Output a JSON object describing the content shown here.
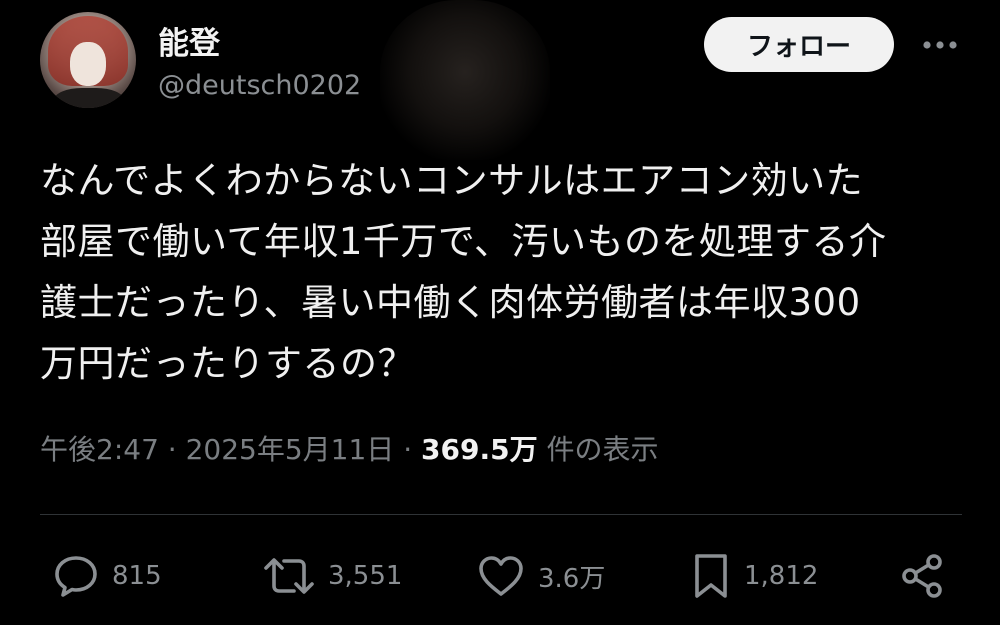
{
  "author": {
    "display_name": "能登",
    "handle": "@deutsch0202",
    "follow_label": "フォロー"
  },
  "tweet": {
    "lines": [
      "なんでよくわからないコンサルはエアコン効いた",
      "部屋で働いて年収1千万で、汚いものを処理する介",
      "護士だったり、暑い中働く肉体労働者は年収300",
      "万円だったりするの？"
    ]
  },
  "meta": {
    "time": "午後2:47",
    "separator": "·",
    "date": "2025年5月11日",
    "views_count": "369.5万",
    "views_label": "件の表示"
  },
  "actions": {
    "replies": "815",
    "reposts": "3,551",
    "likes": "3.6万",
    "bookmarks": "1,812"
  },
  "icons": {
    "more": "more-icon",
    "reply": "reply-icon",
    "repost": "repost-icon",
    "like": "like-icon",
    "bookmark": "bookmark-icon",
    "share": "share-icon"
  },
  "colors": {
    "background": "#000000",
    "text": "#e7e9ea",
    "muted": "#8b8f93",
    "follow_button_bg": "#f2f2f2"
  }
}
